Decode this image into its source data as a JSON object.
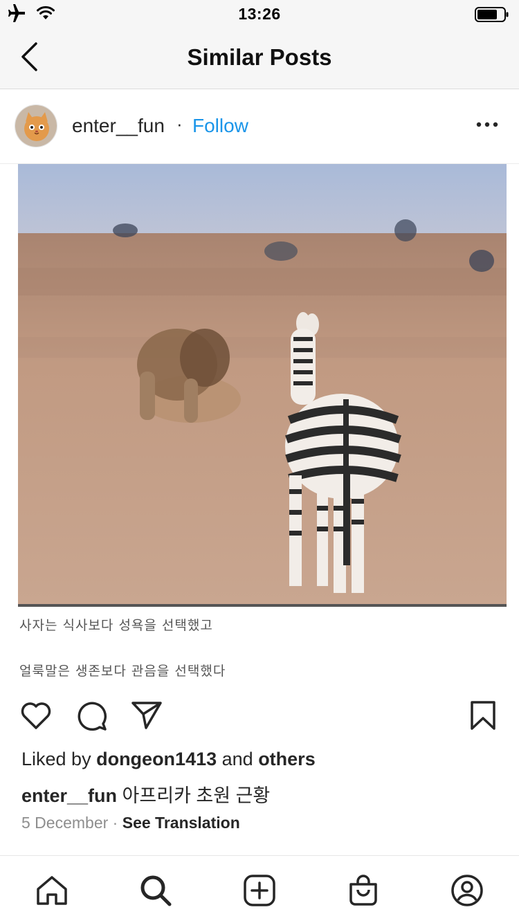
{
  "status_bar": {
    "time": "13:26"
  },
  "header": {
    "title": "Similar Posts"
  },
  "post": {
    "username": "enter__fun",
    "separator": "·",
    "follow_label": "Follow",
    "image_caption_line1": "사자는 식사보다 성욕을 선택했고",
    "image_caption_line2": "얼룩말은 생존보다 관음을 선택했다",
    "likes_prefix": "Liked by ",
    "likes_user": "dongeon1413",
    "likes_middle": " and ",
    "likes_others": "others",
    "caption_user": "enter__fun",
    "caption_text": " 아프리카 초원 근황",
    "date": "5 December",
    "date_separator": " · ",
    "see_translation": "See Translation"
  },
  "colors": {
    "accent": "#1a95e9",
    "text": "#262626",
    "muted": "#8e8e8e"
  },
  "icons": {
    "status": [
      "airplane-icon",
      "wifi-icon",
      "battery-icon"
    ],
    "actions": [
      "heart-icon",
      "comment-icon",
      "share-icon",
      "bookmark-icon"
    ],
    "tabs": [
      "home-icon",
      "search-icon",
      "add-icon",
      "shop-icon",
      "profile-icon"
    ]
  }
}
